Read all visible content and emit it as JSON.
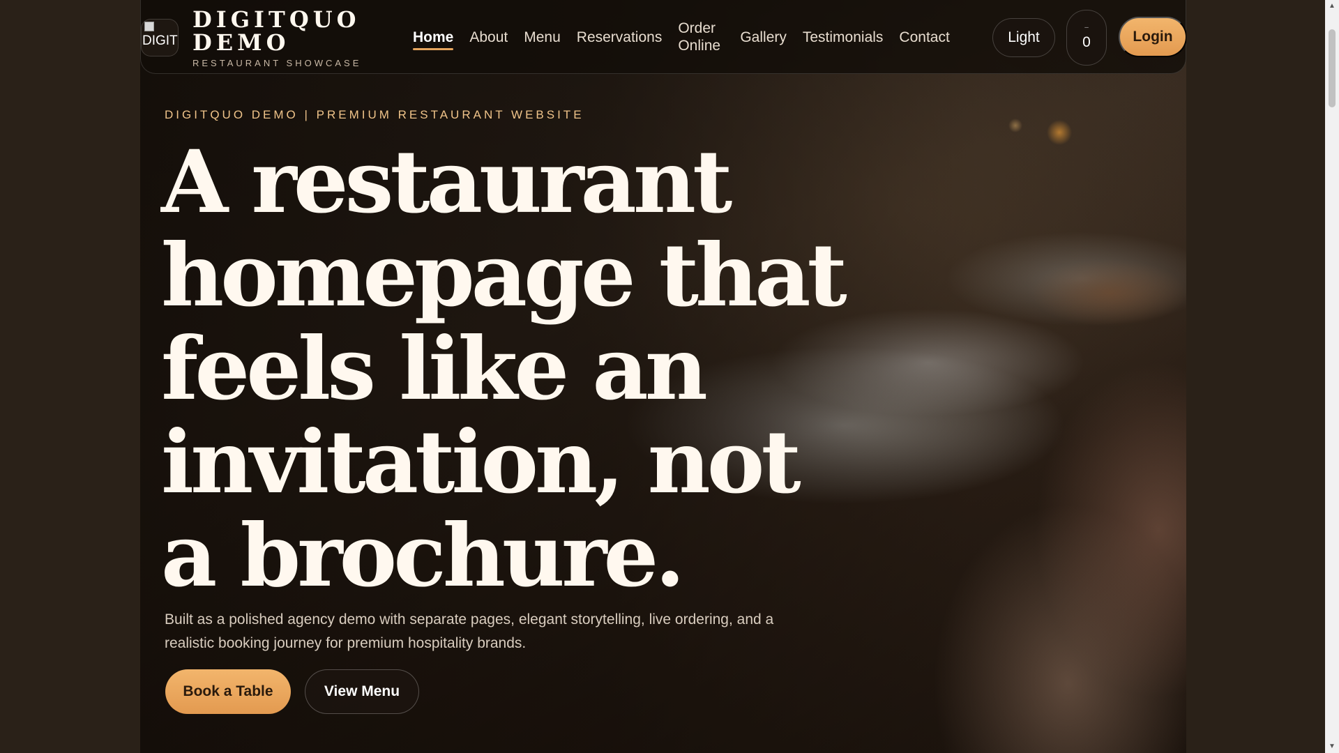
{
  "brand": {
    "logo_alt": "DIGITQUO",
    "name": "DIGITQUO DEMO",
    "tagline": "RESTAURANT SHOWCASE"
  },
  "nav": {
    "items": [
      {
        "label": "Home",
        "active": true
      },
      {
        "label": "About"
      },
      {
        "label": "Menu"
      },
      {
        "label": "Reservations"
      },
      {
        "label": "Order Online"
      },
      {
        "label": "Gallery"
      },
      {
        "label": "Testimonials"
      },
      {
        "label": "Contact"
      }
    ]
  },
  "header_actions": {
    "theme_label": "Light",
    "cart_icon": "cart-icon",
    "cart_count": "0",
    "login_label": "Login"
  },
  "hero": {
    "eyebrow": "DIGITQUO DEMO | PREMIUM RESTAURANT WEBSITE",
    "headline": "A restaurant homepage that feels like an invitation, not a brochure.",
    "lead": "Built as a polished agency demo with separate pages, elegant storytelling, live ordering, and a realistic booking journey for premium hospitality brands.",
    "primary_cta": "Book a Table",
    "secondary_cta": "View Menu"
  },
  "colors": {
    "accent": "#e6a55e",
    "background": "#2a2118",
    "text": "#fff8ef"
  }
}
